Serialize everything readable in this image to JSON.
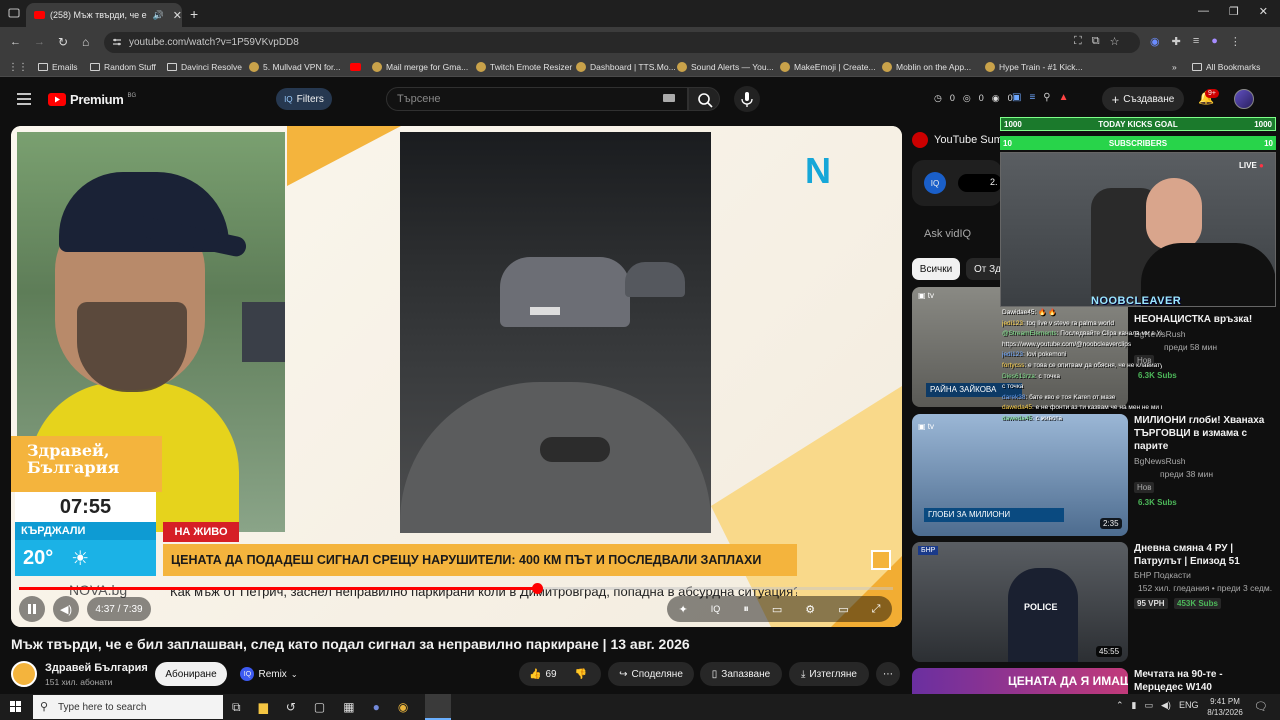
{
  "browser": {
    "tab": {
      "title": "(258) Мъж твърди, че е бил",
      "favicon": "youtube-icon"
    },
    "new_tab_label": "+",
    "url": "youtube.com/watch?v=1P59VKvpDD8",
    "bookmarks": [
      {
        "label": "Emails",
        "icon": "folder-icon"
      },
      {
        "label": "Random Stuff",
        "icon": "folder-icon"
      },
      {
        "label": "Davinci Resolve",
        "icon": "folder-icon"
      },
      {
        "label": "5. Mullvad VPN for...",
        "icon": "bookmark-icon"
      },
      {
        "label": "",
        "icon": "youtube-icon"
      },
      {
        "label": "Mail merge for Gma...",
        "icon": "bookmark-icon"
      },
      {
        "label": "Twitch Emote Resizer",
        "icon": "bookmark-icon"
      },
      {
        "label": "Dashboard | TTS.Mo...",
        "icon": "bookmark-icon"
      },
      {
        "label": "Sound Alerts — You...",
        "icon": "bookmark-icon"
      },
      {
        "label": "MakeEmoji | Create...",
        "icon": "bookmark-icon"
      },
      {
        "label": "Moblin on the App...",
        "icon": "bookmark-icon"
      },
      {
        "label": "Hype Train - #1 Kick...",
        "icon": "bookmark-icon"
      }
    ],
    "all_bookmarks": "All Bookmarks"
  },
  "youtube": {
    "logo": "Premium",
    "logo_region": "BG",
    "filters": "Filters",
    "search_placeholder": "Търсене",
    "stats": [
      "0",
      "0",
      "0"
    ],
    "create": "Създаване",
    "notif_count": "9+"
  },
  "player": {
    "show_name": "Здравей, България",
    "time": "07:55",
    "city": "КЪРДЖАЛИ",
    "temp": "20°",
    "live": "НА ЖИВО",
    "headline": "ЦЕНАТА ДА ПОДАДЕШ СИГНАЛ СРЕЩУ НАРУШИТЕЛИ: 400 КМ ПЪТ И ПОСЛЕДВАЛИ ЗАПЛАХИ",
    "subline": "Как мъж от Петрич, заснел неправилно паркирани коли в Димитровград, попадна в абсурдна ситуация?",
    "watermark": "NOVA.bg",
    "channel_logo": "N",
    "progress": 0.593,
    "time_display": "4:37 / 7:39"
  },
  "video": {
    "title": "Мъж твърди, че е бил заплашван, след като подал сигнал за неправилно паркиране | 13 авг. 2026",
    "channel": "Здравей България",
    "subs": "151 хил. абонати",
    "subscribe": "Абониране",
    "remix": "Remix",
    "likes": "69",
    "share": "Споделяне",
    "save": "Запазване",
    "download": "Изтегляне"
  },
  "sidebar": {
    "summary_label": "YouTube Sum",
    "iq_value": "2.",
    "ask": "Ask vidIQ",
    "chip_all": "Всички",
    "chip_other": "От Зд",
    "items": [
      {
        "title": "НЕОНАЦИСТКА връзка!",
        "channel": "BgNewsRush",
        "meta": "преди 58 мин",
        "badge": "Нов",
        "subs": "6.3K Subs",
        "thumb_caption": "РАЙНА ЗАЙКОВА",
        "duration": ""
      },
      {
        "title": "МИЛИОНИ глоби! Хванаха ТЪРГОВЦИ в измама с парите",
        "channel": "BgNewsRush",
        "meta": "преди 38 мин",
        "badge": "Нов",
        "subs": "6.3K Subs",
        "thumb_caption": "ГЛОБИ ЗА МИЛИОНИ",
        "duration": "2:35"
      },
      {
        "title": "Дневна смяна 4 РУ | Патрулът | Епизод 51",
        "channel": "БНР Подкасти",
        "meta": "152 хил. гледания • преди 3 седм.",
        "badge": "95 VPH",
        "subs": "453K Subs",
        "thumb_caption": "POLICE",
        "duration": "45:55"
      },
      {
        "title": "Мечтата на 90-те - Мерцедес W140",
        "channel": "",
        "meta": "",
        "badge": "",
        "subs": "",
        "thumb_caption": "ЦЕНАТА ДА Я ИМАШ",
        "duration": ""
      }
    ]
  },
  "overlay": {
    "goal_left": "1000",
    "goal_label": "TODAY KICKS GOAL",
    "goal_right": "1000",
    "subs_left": "10",
    "subs_label": "SUBSCRIBERS",
    "subs_right": "10",
    "live": "LIVE",
    "streamer": "NOOBCLEAVER",
    "chat": [
      {
        "user": "",
        "msg": "Dawidae45: 🔥 🔥"
      },
      {
        "user": "jedi123",
        "msg": "toq live v steve ra palma world"
      },
      {
        "user": "@StreamElements",
        "msg": "Последвайте Clipa канала ми в YouTube! Абонирай се тук:"
      },
      {
        "user": "",
        "msg": "https://www.youtube.com/@noobcleaverclips"
      },
      {
        "user": "jedi123",
        "msg": "lovi pokemoni"
      },
      {
        "user": "fortycss",
        "msg": "е това се опитвам да обясня, че не клавиатурата като пиша"
      },
      {
        "user": "Dies613rza",
        "msg": "с точка"
      },
      {
        "user": "",
        "msg": "с точка"
      },
      {
        "user": "darek38",
        "msg": "бате кво е тоя Karen от мазе"
      },
      {
        "user": "daweda45",
        "msg": "е не фонти аз ти казвам че на мен не ми пука кво ще се случва"
      },
      {
        "user": "daweda45",
        "msg": "с живота"
      }
    ]
  },
  "taskbar": {
    "search": "Type here to search",
    "lang": "ENG",
    "time": "9:41 PM",
    "date": "8/13/2026"
  }
}
